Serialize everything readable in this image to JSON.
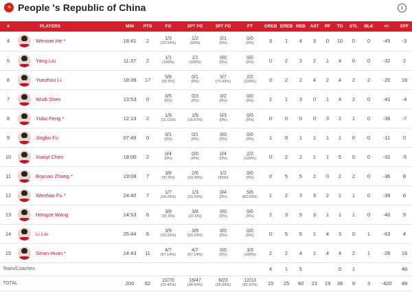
{
  "header": {
    "title": "People 's Republic of China",
    "info_icon": "info-icon",
    "flag_icon": "china-flag-icon"
  },
  "colors": {
    "accent": "#d11f2b",
    "player_name": "#c8102e"
  },
  "columns": [
    "#",
    "PLAYERS",
    "MIN",
    "PTS",
    "FG",
    "2PT FG",
    "3PT FG",
    "FT",
    "OREB",
    "DREB",
    "REB",
    "AST",
    "PF",
    "TO",
    "STL",
    "BLK",
    "+/-",
    "EFF"
  ],
  "rows": [
    {
      "no": "4",
      "name": "Wenwei He *",
      "min": "18:41",
      "pts": "2",
      "fg": [
        "1/3",
        "(33.33%)"
      ],
      "fg2": [
        "1/2",
        "(50%)"
      ],
      "fg3": [
        "0/1",
        "(0%)"
      ],
      "ft": [
        "0/0",
        "(0%)"
      ],
      "oreb": "3",
      "dreb": "1",
      "reb": "4",
      "ast": "3",
      "pf": "0",
      "to": "10",
      "stl": "0",
      "blk": "0",
      "pm": "-45",
      "eff": "-3"
    },
    {
      "no": "5",
      "name": "Yang Liu",
      "min": "11:37",
      "pts": "2",
      "fg": [
        "1/1",
        "(100%)"
      ],
      "fg2": [
        "1/1",
        "(100%)"
      ],
      "fg3": [
        "0/0",
        "(0%)"
      ],
      "ft": [
        "0/0",
        "(0%)"
      ],
      "oreb": "0",
      "dreb": "2",
      "reb": "2",
      "ast": "2",
      "pf": "1",
      "to": "4",
      "stl": "0",
      "blk": "0",
      "pm": "-32",
      "eff": "2"
    },
    {
      "no": "6",
      "name": "Yuezhou Li",
      "min": "18:39",
      "pts": "17",
      "fg": [
        "5/8",
        "(62.5%)"
      ],
      "fg2": [
        "0/1",
        "(0%)"
      ],
      "fg3": [
        "5/7",
        "(71.43%)"
      ],
      "ft": [
        "2/2",
        "(100%)"
      ],
      "oreb": "0",
      "dreb": "2",
      "reb": "2",
      "ast": "4",
      "pf": "2",
      "to": "4",
      "stl": "2",
      "blk": "2",
      "pm": "-20",
      "eff": "18"
    },
    {
      "no": "7",
      "name": "Wudi Shen",
      "min": "13:53",
      "pts": "0",
      "fg": [
        "0/5",
        "(0%)"
      ],
      "fg2": [
        "0/3",
        "(0%)"
      ],
      "fg3": [
        "0/2",
        "(0%)"
      ],
      "ft": [
        "0/0",
        "(0%)"
      ],
      "oreb": "2",
      "dreb": "1",
      "reb": "3",
      "ast": "0",
      "pf": "1",
      "to": "4",
      "stl": "2",
      "blk": "0",
      "pm": "-41",
      "eff": "-4"
    },
    {
      "no": "8",
      "name": "Yubo Feng *",
      "min": "12:13",
      "pts": "2",
      "fg": [
        "1/9",
        "(11.11%)"
      ],
      "fg2": [
        "1/6",
        "(16.67%)"
      ],
      "fg3": [
        "0/3",
        "(0%)"
      ],
      "ft": [
        "0/0",
        "(0%)"
      ],
      "oreb": "0",
      "dreb": "0",
      "reb": "0",
      "ast": "0",
      "pf": "3",
      "to": "2",
      "stl": "1",
      "blk": "0",
      "pm": "-36",
      "eff": "-7"
    },
    {
      "no": "9",
      "name": "Jingbo Fu",
      "min": "07:49",
      "pts": "0",
      "fg": [
        "0/1",
        "(0%)"
      ],
      "fg2": [
        "0/1",
        "(0%)"
      ],
      "fg3": [
        "0/0",
        "(0%)"
      ],
      "ft": [
        "0/0",
        "(0%)"
      ],
      "oreb": "1",
      "dreb": "0",
      "reb": "1",
      "ast": "1",
      "pf": "1",
      "to": "1",
      "stl": "0",
      "blk": "0",
      "pm": "-11",
      "eff": "0"
    },
    {
      "no": "10",
      "name": "Xiaoyi Chen",
      "min": "18:00",
      "pts": "2",
      "fg": [
        "0/4",
        "(0%)"
      ],
      "fg2": [
        "0/0",
        "(0%)"
      ],
      "fg3": [
        "0/4",
        "(0%)"
      ],
      "ft": [
        "2/2",
        "(100%)"
      ],
      "oreb": "0",
      "dreb": "2",
      "reb": "2",
      "ast": "1",
      "pf": "1",
      "to": "5",
      "stl": "0",
      "blk": "0",
      "pm": "-31",
      "eff": "-5"
    },
    {
      "no": "11",
      "name": "Boyuan Zhang *",
      "min": "19:08",
      "pts": "7",
      "fg": [
        "3/8",
        "(37.5%)"
      ],
      "fg2": [
        "2/6",
        "(33.33%)"
      ],
      "fg3": [
        "1/2",
        "(50%)"
      ],
      "ft": [
        "0/0",
        "(0%)"
      ],
      "oreb": "0",
      "dreb": "5",
      "reb": "5",
      "ast": "2",
      "pf": "0",
      "to": "2",
      "stl": "2",
      "blk": "0",
      "pm": "-36",
      "eff": "8"
    },
    {
      "no": "12",
      "name": "Wenhao Fu *",
      "min": "24:40",
      "pts": "7",
      "fg": [
        "1/7",
        "(14.29%)"
      ],
      "fg2": [
        "1/3",
        "(33.33%)"
      ],
      "fg3": [
        "0/4",
        "(0%)"
      ],
      "ft": [
        "5/6",
        "(83.33%)"
      ],
      "oreb": "1",
      "dreb": "2",
      "reb": "3",
      "ast": "3",
      "pf": "2",
      "to": "1",
      "stl": "1",
      "blk": "0",
      "pm": "-39",
      "eff": "6"
    },
    {
      "no": "13",
      "name": "Hongze Wang",
      "min": "14:53",
      "pts": "6",
      "fg": [
        "3/8",
        "(37.5%)"
      ],
      "fg2": [
        "3/8",
        "(37.5%)"
      ],
      "fg3": [
        "0/0",
        "(0%)"
      ],
      "ft": [
        "0/0",
        "(0%)"
      ],
      "oreb": "2",
      "dreb": "3",
      "reb": "5",
      "ast": "3",
      "pf": "1",
      "to": "1",
      "stl": "1",
      "blk": "0",
      "pm": "-40",
      "eff": "9"
    },
    {
      "no": "14",
      "name": "Li Liu",
      "min": "25:44",
      "pts": "6",
      "fg": [
        "3/9",
        "(33.33%)"
      ],
      "fg2": [
        "3/9",
        "(33.33%)"
      ],
      "fg3": [
        "0/0",
        "(0%)"
      ],
      "ft": [
        "0/0",
        "(0%)"
      ],
      "oreb": "0",
      "dreb": "5",
      "reb": "5",
      "ast": "1",
      "pf": "4",
      "to": "3",
      "stl": "0",
      "blk": "1",
      "pm": "-63",
      "eff": "4"
    },
    {
      "no": "15",
      "name": "Sinan Huan *",
      "min": "14:43",
      "pts": "11",
      "fg": [
        "4/7",
        "(57.14%)"
      ],
      "fg2": [
        "4/7",
        "(57.14%)"
      ],
      "fg3": [
        "0/0",
        "(0%)"
      ],
      "ft": [
        "3/3",
        "(100%)"
      ],
      "oreb": "2",
      "dreb": "2",
      "reb": "4",
      "ast": "1",
      "pf": "4",
      "to": "4",
      "stl": "2",
      "blk": "1",
      "pm": "-26",
      "eff": "16"
    }
  ],
  "team_coaches": {
    "label": "Team/Coaches",
    "oreb": "4",
    "dreb": "1",
    "reb": "5",
    "to": "0",
    "stl": "1",
    "eff": "48"
  },
  "total": {
    "label": "TOTAL",
    "min": "200",
    "pts": "62",
    "fg": [
      "22/70",
      "(31.43%)"
    ],
    "fg2": [
      "16/47",
      "(34.04%)"
    ],
    "fg3": [
      "6/23",
      "(26.09%)"
    ],
    "ft": [
      "12/13",
      "(92.31%)"
    ],
    "oreb": "15",
    "dreb": "25",
    "reb": "40",
    "ast": "21",
    "pf": "19",
    "to": "38",
    "stl": "9",
    "blk": "3",
    "pm": "-420",
    "eff": "48"
  }
}
